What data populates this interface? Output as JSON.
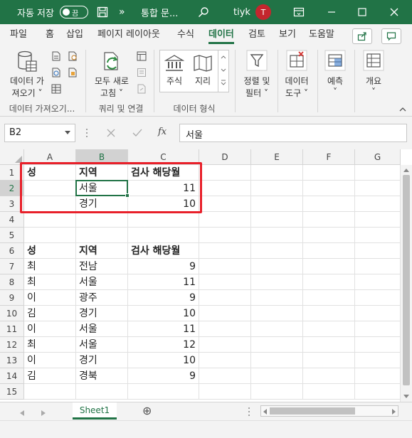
{
  "titlebar": {
    "autosave_label": "자동 저장",
    "toggle_state": "끔",
    "more": "»",
    "file_name": "통합 문...",
    "user": "tiyk",
    "avatar_letter": "T",
    "colors": {
      "brand": "#217346",
      "avatar": "#c4262e"
    }
  },
  "tabs": [
    "파일",
    "홈",
    "삽입",
    "페이지 레이아웃",
    "수식",
    "데이터",
    "검토",
    "보기",
    "도움말"
  ],
  "active_tab": "데이터",
  "ribbon": {
    "get_data": {
      "line1": "데이터 가",
      "line2": "져오기 ˅"
    },
    "refresh_all": {
      "line1": "모두 새로",
      "line2": "고침 ˅"
    },
    "stocks": "주식",
    "geography": "지리",
    "sort_filter": {
      "line1": "정렬 및",
      "line2": "필터 ˅"
    },
    "data_tools": {
      "line1": "데이터",
      "line2": "도구 ˅"
    },
    "forecast": {
      "line1": "예측",
      "line2": "˅"
    },
    "outline": {
      "line1": "개요",
      "line2": "˅"
    },
    "groups": {
      "get_transform": "데이터 가져오기...",
      "queries": "쿼리 및 연결",
      "data_types": "데이터 형식"
    }
  },
  "formula_bar": {
    "name_box": "B2",
    "fx": "fx",
    "value": "서울"
  },
  "columns": [
    "A",
    "B",
    "C",
    "D",
    "E",
    "F",
    "G"
  ],
  "rows": [
    "1",
    "2",
    "3",
    "4",
    "5",
    "6",
    "7",
    "8",
    "9",
    "10",
    "11",
    "12",
    "13",
    "14",
    "15"
  ],
  "cells": {
    "A1": "성",
    "B1": "지역",
    "C1": "검사 해당월",
    "A2": "",
    "B2": "서울",
    "C2": "11",
    "A3": "",
    "B3": "경기",
    "C3": "10",
    "A6": "성",
    "B6": "지역",
    "C6": "검사 해당월",
    "A7": "최",
    "B7": "전남",
    "C7": "9",
    "A8": "최",
    "B8": "서울",
    "C8": "11",
    "A9": "이",
    "B9": "광주",
    "C9": "9",
    "A10": "김",
    "B10": "경기",
    "C10": "10",
    "A11": "이",
    "B11": "서울",
    "C11": "11",
    "A12": "최",
    "B12": "서울",
    "C12": "12",
    "A13": "이",
    "B13": "경기",
    "C13": "10",
    "A14": "김",
    "B14": "경북",
    "C14": "9"
  },
  "sheet_tab": "Sheet1",
  "add_sheet": "⊕"
}
